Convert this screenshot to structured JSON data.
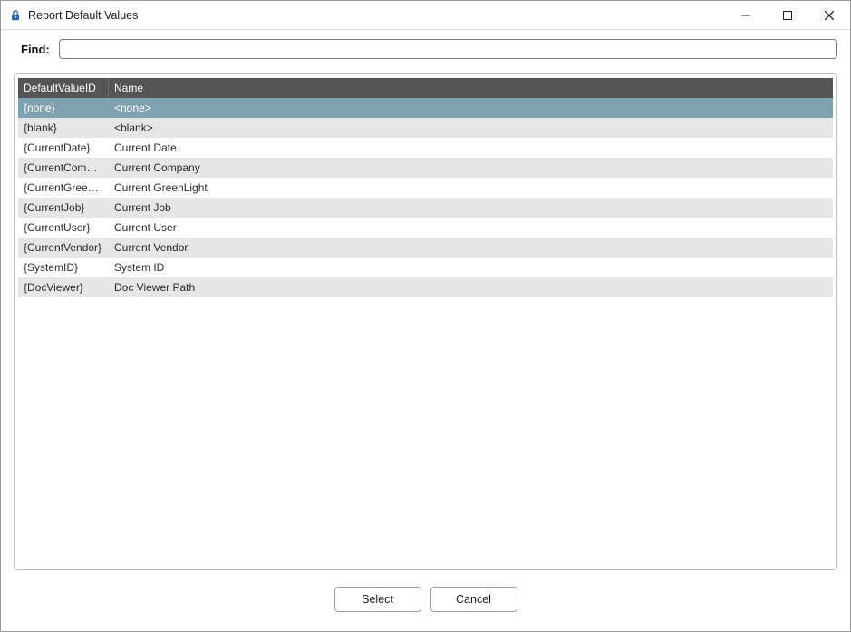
{
  "window": {
    "title": "Report Default Values"
  },
  "find": {
    "label": "Find:",
    "value": ""
  },
  "table": {
    "columns": {
      "id": "DefaultValueID",
      "name": "Name"
    },
    "rows": [
      {
        "id": "{none}",
        "name": "<none>",
        "selected": true
      },
      {
        "id": "{blank}",
        "name": "<blank>",
        "selected": false
      },
      {
        "id": "{CurrentDate}",
        "name": "Current Date",
        "selected": false
      },
      {
        "id": "{CurrentCompany}",
        "name": "Current Company",
        "selected": false
      },
      {
        "id": "{CurrentGreenLig...",
        "name": "Current GreenLight",
        "selected": false
      },
      {
        "id": "{CurrentJob}",
        "name": "Current Job",
        "selected": false
      },
      {
        "id": "{CurrentUser}",
        "name": "Current User",
        "selected": false
      },
      {
        "id": "{CurrentVendor}",
        "name": "Current Vendor",
        "selected": false
      },
      {
        "id": "{SystemID}",
        "name": "System ID",
        "selected": false
      },
      {
        "id": "{DocViewer}",
        "name": "Doc Viewer Path",
        "selected": false
      }
    ]
  },
  "buttons": {
    "select": "Select",
    "cancel": "Cancel"
  }
}
